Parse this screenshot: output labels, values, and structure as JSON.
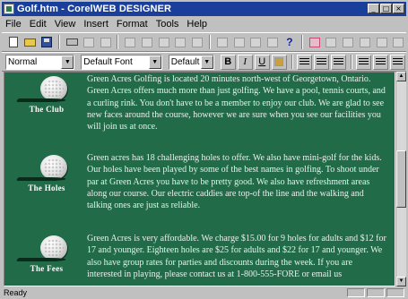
{
  "window": {
    "title": "Golf.htm - CorelWEB DESIGNER",
    "controls": [
      "_",
      "□",
      "×"
    ]
  },
  "menu": [
    "File",
    "Edit",
    "View",
    "Insert",
    "Format",
    "Tools",
    "Help"
  ],
  "format_toolbar": {
    "style": "Normal",
    "font": "Default Font",
    "size": "Default",
    "bold": "B",
    "italic": "I",
    "underline": "U"
  },
  "sections": [
    {
      "label": "The Club",
      "text": "Green Acres Golfing is located 20 minutes north-west of Georgetown, Ontario. Green Acres offers much more than just golfing. We have a pool, tennis courts, and a curling rink. You don't have to be a member to enjoy our club. We are glad to see new faces around the course, however we are sure when you see our facilities you will join us at once."
    },
    {
      "label": "The Holes",
      "text": "Green acres has 18 challenging holes to offer. We also have mini-golf for the kids. Our holes have been played by some of the best names in golfing. To shoot under par at Green Acres you have to be pretty good. We also have refreshment areas along our course. Our electric caddies are top-of the line and the walking and talking ones are just as reliable."
    },
    {
      "label": "The Fees",
      "text": "Green Acres is very affordable. We charge $15.00 for 9 holes for adults and $12 for 17 and younger. Eighteen holes are $25 for adults and $22 for 17 and younger. We also have group rates for parties and discounts during the week. If you are interested in playing, please contact us at 1-800-555-FORE or email us"
    }
  ],
  "status": {
    "text": "Ready"
  },
  "colors": {
    "title_bar": "#1a3f9a",
    "page_background": "#226b49",
    "body_text": "#e8f2ec"
  }
}
